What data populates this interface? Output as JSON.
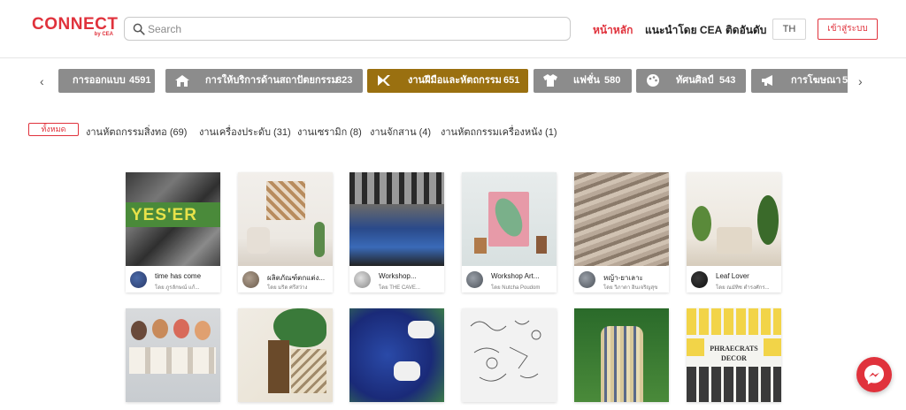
{
  "header": {
    "logo_text": "CONNECT",
    "logo_sub": "by CEA",
    "search_placeholder": "Search",
    "nav": [
      "หน้าหลัก",
      "แนะนำโดย CEA",
      "ติดอันดับ"
    ],
    "lang": "TH",
    "login": "เข้าสู่ระบบ"
  },
  "categories": [
    {
      "label": "การออกแบบ",
      "count": "4591",
      "icon": "design-icon"
    },
    {
      "label": "การให้บริการด้านสถาปัตยกรรม",
      "count": "823",
      "icon": "house-icon"
    },
    {
      "label": "งานฝีมือและหัตถกรรม",
      "count": "651",
      "icon": "craft-tools-icon"
    },
    {
      "label": "แฟชั่น",
      "count": "580",
      "icon": "shirt-icon"
    },
    {
      "label": "ทัศนศิลป์",
      "count": "543",
      "icon": "palette-icon"
    },
    {
      "label": "การโฆษณา",
      "count": "5",
      "icon": "megaphone-icon"
    }
  ],
  "filters": {
    "all": "ทั้งหมด",
    "items": [
      "งานหัตถกรรมสิ่งทอ (69)",
      "งานเครื่องประดับ (31)",
      "งานเซรามิก (8)",
      "งานจักสาน (4)",
      "งานหัตถกรรมเครื่องหนัง (1)"
    ]
  },
  "cards": [
    {
      "title": "time has come",
      "author": "โดย ภูรลักษณ์ แก้...",
      "thumb_text": "YES'ER"
    },
    {
      "title": "ผลิตภัณฑ์ตกแต่ง...",
      "author": "โดย มริด ศรีสว่าง",
      "thumb_text": ""
    },
    {
      "title": "Workshop...",
      "author": "โดย THE CAVE...",
      "thumb_text": ""
    },
    {
      "title": "Workshop Art...",
      "author": "โดย Nutcha Poudom",
      "thumb_text": ""
    },
    {
      "title": "หญ้า-ยาเลาะ",
      "author": "โดย วิภาดา อินเจริญสุข",
      "thumb_text": ""
    },
    {
      "title": "Leaf Lover",
      "author": "โดย ณมัทิช ตำรงศักร...",
      "thumb_text": ""
    },
    {
      "title": "",
      "author": "",
      "thumb_text": ""
    },
    {
      "title": "",
      "author": "",
      "thumb_text": ""
    },
    {
      "title": "",
      "author": "",
      "thumb_text": ""
    },
    {
      "title": "",
      "author": "",
      "thumb_text": ""
    },
    {
      "title": "",
      "author": "",
      "thumb_text": ""
    },
    {
      "title": "",
      "author": "",
      "thumb_text": "PHRAECRATS DECOR"
    }
  ],
  "colors": {
    "brand": "#e0323c",
    "active_category": "#9a7010",
    "category": "#8c8c8c"
  }
}
